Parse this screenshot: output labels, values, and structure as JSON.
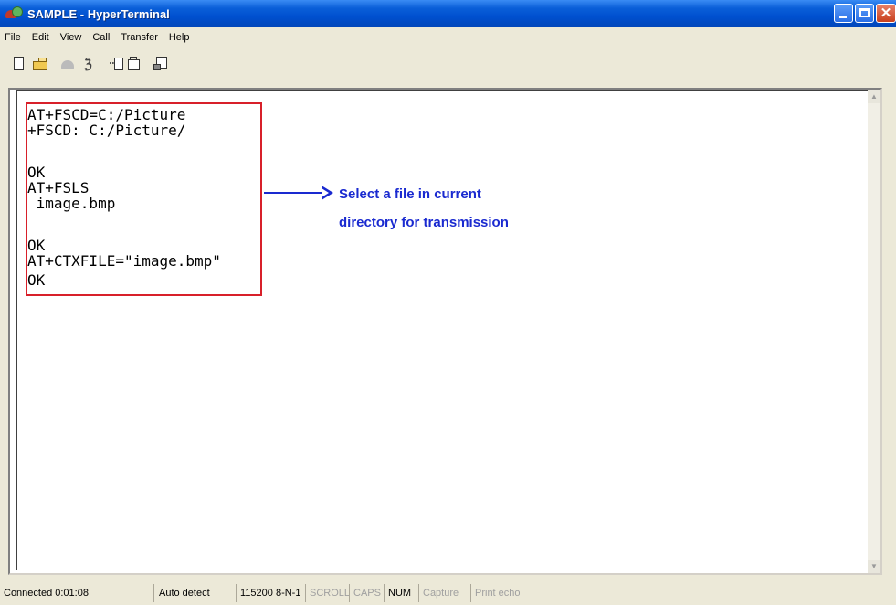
{
  "window": {
    "title": "SAMPLE - HyperTerminal"
  },
  "menu": [
    "File",
    "Edit",
    "View",
    "Call",
    "Transfer",
    "Help"
  ],
  "toolbar": {
    "icons": [
      "new-icon",
      "open-icon",
      "call-icon",
      "disconnect-icon",
      "send-icon",
      "receive-icon",
      "properties-icon"
    ]
  },
  "terminal": {
    "lines": [
      "AT+FSCD=C:/Picture",
      "+FSCD: C:/Picture/",
      "",
      "OK",
      "AT+FSLS",
      " image.bmp",
      "",
      "OK",
      "AT+CTXFILE=\"image.bmp\"",
      "OK"
    ],
    "annotation_line1": "Select a file in current",
    "annotation_line2": "directory for transmission",
    "highlight_color": "#d8202a",
    "annotation_color": "#1a2ad0"
  },
  "status": {
    "connected": "Connected 0:01:08",
    "detect": "Auto detect",
    "port": "115200 8-N-1",
    "scroll": "SCROLL",
    "caps": "CAPS",
    "num": "NUM",
    "capture": "Capture",
    "print_echo": "Print echo"
  }
}
